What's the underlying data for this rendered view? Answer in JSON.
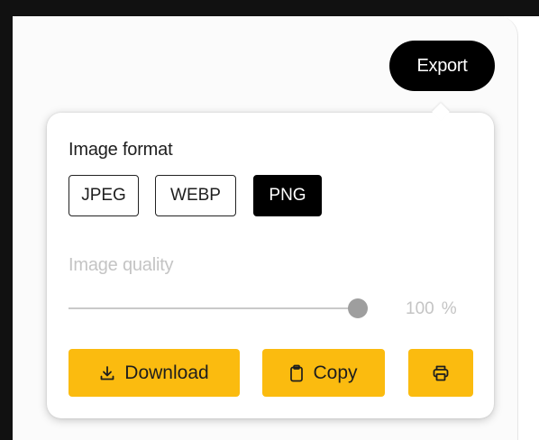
{
  "toolbar": {
    "export_label": "Export"
  },
  "export_panel": {
    "format_label": "Image format",
    "formats": [
      {
        "label": "JPEG",
        "selected": false
      },
      {
        "label": "WEBP",
        "selected": false
      },
      {
        "label": "PNG",
        "selected": true
      }
    ],
    "quality_label": "Image quality",
    "quality": {
      "value": "100",
      "unit": "%",
      "slider_fraction": 1.0,
      "disabled": true
    },
    "actions": {
      "download_label": "Download",
      "download_icon": "download-icon",
      "copy_label": "Copy",
      "copy_icon": "clipboard-icon",
      "print_icon": "print-icon"
    }
  },
  "colors": {
    "accent": "#fbbb0f",
    "selected_chip": "#000000",
    "disabled_text": "#c4c4c4"
  }
}
